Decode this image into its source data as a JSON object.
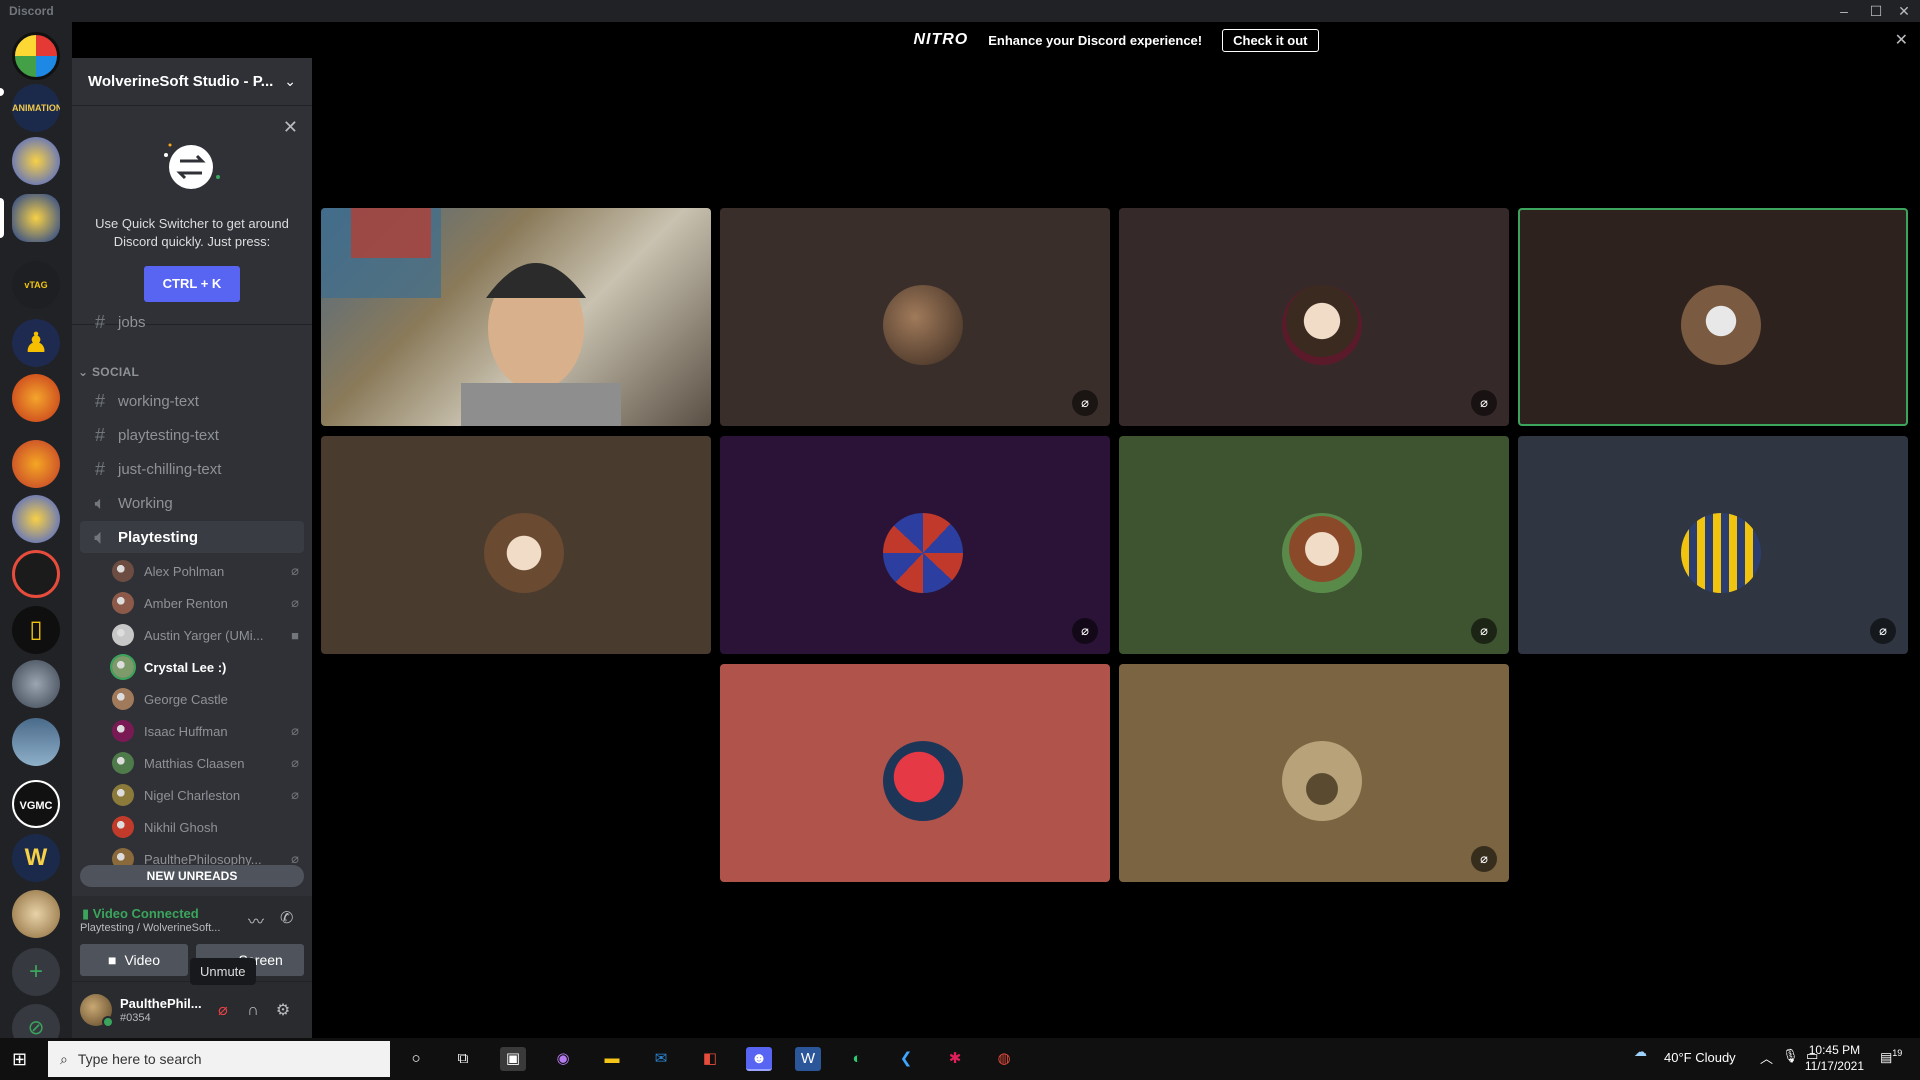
{
  "window": {
    "title": "Discord"
  },
  "nitro": {
    "logo": "NITRO",
    "message": "Enhance your Discord experience!",
    "cta": "Check it out"
  },
  "guild": {
    "name": "WolverineSoft Studio - P..."
  },
  "quick_switcher": {
    "text": "Use Quick Switcher to get around Discord quickly. Just press:",
    "shortcut": "CTRL + K"
  },
  "channels": {
    "partial_top": "jobs",
    "category": "SOCIAL",
    "items": [
      {
        "name": "working-text",
        "type": "text"
      },
      {
        "name": "playtesting-text",
        "type": "text"
      },
      {
        "name": "just-chilling-text",
        "type": "text"
      },
      {
        "name": "Working",
        "type": "voice"
      },
      {
        "name": "Playtesting",
        "type": "voice",
        "active": true
      }
    ]
  },
  "voice_users": [
    {
      "name": "Alex Pohlman",
      "status": "muted",
      "color": "#6d4c41"
    },
    {
      "name": "Amber Renton",
      "status": "muted",
      "color": "#8d5a4a"
    },
    {
      "name": "Austin Yarger (UMi...",
      "status": "video",
      "color": "#c7c7c7"
    },
    {
      "name": "Crystal Lee :)",
      "status": "speaking",
      "color": "#7c9a6a"
    },
    {
      "name": "George Castle",
      "status": "none",
      "color": "#a07a5a"
    },
    {
      "name": "Isaac Huffman",
      "status": "muted",
      "color": "#7a1a55"
    },
    {
      "name": "Matthias Claasen",
      "status": "muted",
      "color": "#4f7a4a"
    },
    {
      "name": "Nigel Charleston",
      "status": "muted",
      "color": "#8b7a3a"
    },
    {
      "name": "Nikhil Ghosh",
      "status": "none",
      "color": "#c23a2a"
    },
    {
      "name": "PaulthePhilosophy...",
      "status": "muted",
      "color": "#8a6a3a"
    }
  ],
  "new_unreads": "NEW UNREADS",
  "rtc": {
    "status": "Video Connected",
    "sub": "Playtesting / WolverineSoft...",
    "video": "Video",
    "screen": "Screen"
  },
  "user": {
    "name": "PaulthePhil...",
    "tag": "#0354"
  },
  "tooltip": "Unmute",
  "taskbar": {
    "search_placeholder": "Type here to search",
    "weather": "40°F  Cloudy",
    "time": "10:45 PM",
    "date": "11/17/2021",
    "notifications": "19"
  },
  "colors": {
    "accent": "#5865f2",
    "speaking": "#3ba55d"
  }
}
